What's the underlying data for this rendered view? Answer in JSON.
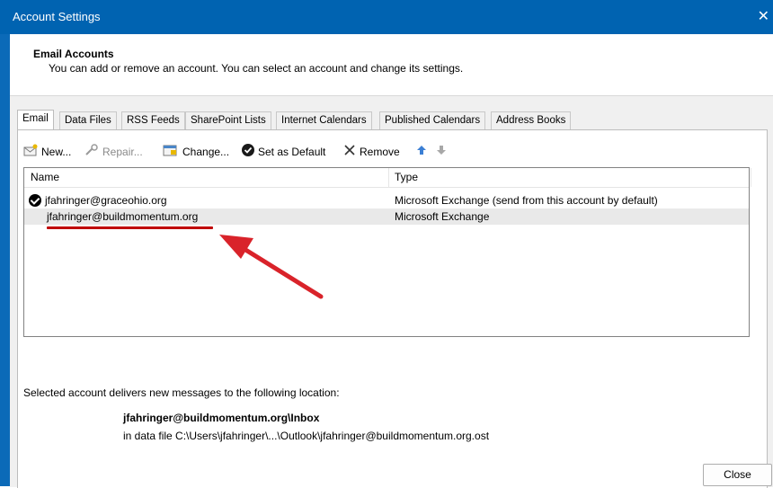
{
  "window": {
    "title": "Account Settings",
    "close_glyph": "✕"
  },
  "header": {
    "title": "Email Accounts",
    "description": "You can add or remove an account. You can select an account and change its settings."
  },
  "tabs": [
    {
      "label": "Email",
      "active": true
    },
    {
      "label": "Data Files"
    },
    {
      "label": "RSS Feeds"
    },
    {
      "label": "SharePoint Lists"
    },
    {
      "label": "Internet Calendars"
    },
    {
      "label": "Published Calendars"
    },
    {
      "label": "Address Books"
    }
  ],
  "toolbar": {
    "new_label": "New...",
    "repair_label": "Repair...",
    "change_label": "Change...",
    "default_label": "Set as Default",
    "remove_label": "Remove"
  },
  "accounts": {
    "col_name": "Name",
    "col_type": "Type",
    "rows": [
      {
        "name": "jfahringer@graceohio.org",
        "type": "Microsoft Exchange (send from this account by default)",
        "default": true
      },
      {
        "name": "jfahringer@buildmomentum.org",
        "type": "Microsoft Exchange",
        "selected": true
      }
    ]
  },
  "location": {
    "label": "Selected account delivers new messages to the following location:",
    "folder": "jfahringer@buildmomentum.org\\Inbox",
    "file": "in data file C:\\Users\\jfahringer\\...\\Outlook\\jfahringer@buildmomentum.org.ost"
  },
  "footer": {
    "close_label": "Close"
  },
  "colors": {
    "titlebar": "#0063b1",
    "annotation": "#d9232a"
  }
}
